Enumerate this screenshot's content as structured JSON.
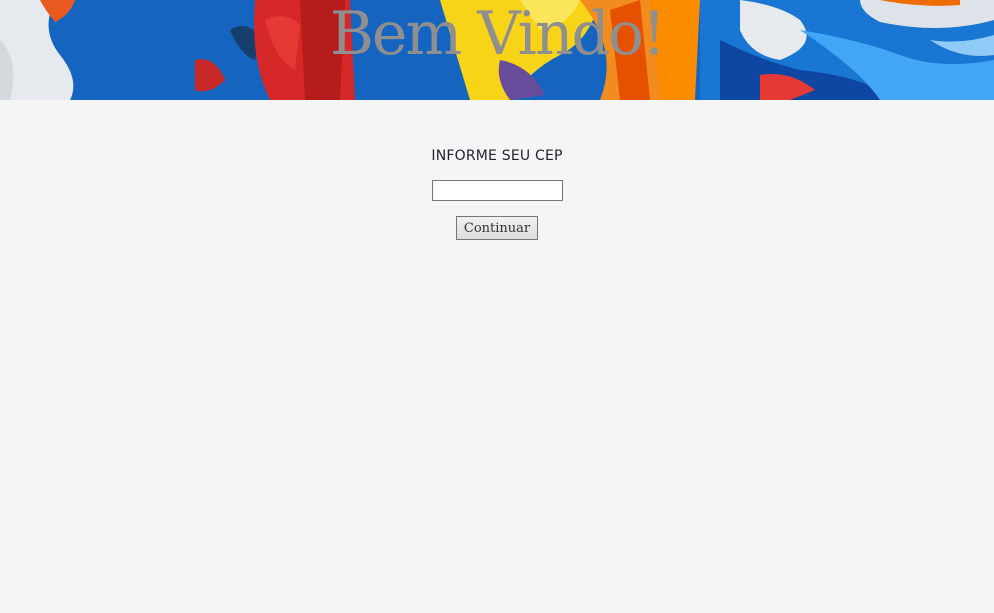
{
  "banner": {
    "title": "Bem Vindo!",
    "palette": [
      "#1565c0",
      "#e32b2b",
      "#f5d20a",
      "#f28c1e",
      "#e9eef2",
      "#0d47a1"
    ]
  },
  "form": {
    "label": "INFORME SEU CEP",
    "cep_value": "",
    "cep_placeholder": "",
    "submit_label": "Continuar"
  },
  "colors": {
    "page_background": "#f5f5f5",
    "label_text": "#1e2333",
    "title_text": "#8f8f8f"
  }
}
